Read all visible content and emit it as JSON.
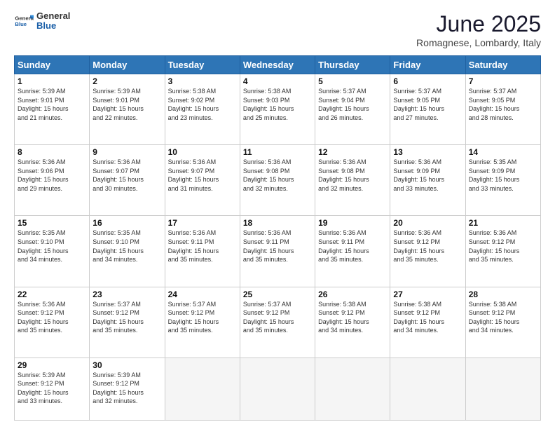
{
  "header": {
    "logo_general": "General",
    "logo_blue": "Blue",
    "month": "June 2025",
    "location": "Romagnese, Lombardy, Italy"
  },
  "weekdays": [
    "Sunday",
    "Monday",
    "Tuesday",
    "Wednesday",
    "Thursday",
    "Friday",
    "Saturday"
  ],
  "weeks": [
    [
      {
        "day": "1",
        "info": "Sunrise: 5:39 AM\nSunset: 9:01 PM\nDaylight: 15 hours\nand 21 minutes."
      },
      {
        "day": "2",
        "info": "Sunrise: 5:39 AM\nSunset: 9:01 PM\nDaylight: 15 hours\nand 22 minutes."
      },
      {
        "day": "3",
        "info": "Sunrise: 5:38 AM\nSunset: 9:02 PM\nDaylight: 15 hours\nand 23 minutes."
      },
      {
        "day": "4",
        "info": "Sunrise: 5:38 AM\nSunset: 9:03 PM\nDaylight: 15 hours\nand 25 minutes."
      },
      {
        "day": "5",
        "info": "Sunrise: 5:37 AM\nSunset: 9:04 PM\nDaylight: 15 hours\nand 26 minutes."
      },
      {
        "day": "6",
        "info": "Sunrise: 5:37 AM\nSunset: 9:05 PM\nDaylight: 15 hours\nand 27 minutes."
      },
      {
        "day": "7",
        "info": "Sunrise: 5:37 AM\nSunset: 9:05 PM\nDaylight: 15 hours\nand 28 minutes."
      }
    ],
    [
      {
        "day": "8",
        "info": "Sunrise: 5:36 AM\nSunset: 9:06 PM\nDaylight: 15 hours\nand 29 minutes."
      },
      {
        "day": "9",
        "info": "Sunrise: 5:36 AM\nSunset: 9:07 PM\nDaylight: 15 hours\nand 30 minutes."
      },
      {
        "day": "10",
        "info": "Sunrise: 5:36 AM\nSunset: 9:07 PM\nDaylight: 15 hours\nand 31 minutes."
      },
      {
        "day": "11",
        "info": "Sunrise: 5:36 AM\nSunset: 9:08 PM\nDaylight: 15 hours\nand 32 minutes."
      },
      {
        "day": "12",
        "info": "Sunrise: 5:36 AM\nSunset: 9:08 PM\nDaylight: 15 hours\nand 32 minutes."
      },
      {
        "day": "13",
        "info": "Sunrise: 5:36 AM\nSunset: 9:09 PM\nDaylight: 15 hours\nand 33 minutes."
      },
      {
        "day": "14",
        "info": "Sunrise: 5:35 AM\nSunset: 9:09 PM\nDaylight: 15 hours\nand 33 minutes."
      }
    ],
    [
      {
        "day": "15",
        "info": "Sunrise: 5:35 AM\nSunset: 9:10 PM\nDaylight: 15 hours\nand 34 minutes."
      },
      {
        "day": "16",
        "info": "Sunrise: 5:35 AM\nSunset: 9:10 PM\nDaylight: 15 hours\nand 34 minutes."
      },
      {
        "day": "17",
        "info": "Sunrise: 5:36 AM\nSunset: 9:11 PM\nDaylight: 15 hours\nand 35 minutes."
      },
      {
        "day": "18",
        "info": "Sunrise: 5:36 AM\nSunset: 9:11 PM\nDaylight: 15 hours\nand 35 minutes."
      },
      {
        "day": "19",
        "info": "Sunrise: 5:36 AM\nSunset: 9:11 PM\nDaylight: 15 hours\nand 35 minutes."
      },
      {
        "day": "20",
        "info": "Sunrise: 5:36 AM\nSunset: 9:12 PM\nDaylight: 15 hours\nand 35 minutes."
      },
      {
        "day": "21",
        "info": "Sunrise: 5:36 AM\nSunset: 9:12 PM\nDaylight: 15 hours\nand 35 minutes."
      }
    ],
    [
      {
        "day": "22",
        "info": "Sunrise: 5:36 AM\nSunset: 9:12 PM\nDaylight: 15 hours\nand 35 minutes."
      },
      {
        "day": "23",
        "info": "Sunrise: 5:37 AM\nSunset: 9:12 PM\nDaylight: 15 hours\nand 35 minutes."
      },
      {
        "day": "24",
        "info": "Sunrise: 5:37 AM\nSunset: 9:12 PM\nDaylight: 15 hours\nand 35 minutes."
      },
      {
        "day": "25",
        "info": "Sunrise: 5:37 AM\nSunset: 9:12 PM\nDaylight: 15 hours\nand 35 minutes."
      },
      {
        "day": "26",
        "info": "Sunrise: 5:38 AM\nSunset: 9:12 PM\nDaylight: 15 hours\nand 34 minutes."
      },
      {
        "day": "27",
        "info": "Sunrise: 5:38 AM\nSunset: 9:12 PM\nDaylight: 15 hours\nand 34 minutes."
      },
      {
        "day": "28",
        "info": "Sunrise: 5:38 AM\nSunset: 9:12 PM\nDaylight: 15 hours\nand 34 minutes."
      }
    ],
    [
      {
        "day": "29",
        "info": "Sunrise: 5:39 AM\nSunset: 9:12 PM\nDaylight: 15 hours\nand 33 minutes."
      },
      {
        "day": "30",
        "info": "Sunrise: 5:39 AM\nSunset: 9:12 PM\nDaylight: 15 hours\nand 32 minutes."
      },
      {
        "day": "",
        "info": ""
      },
      {
        "day": "",
        "info": ""
      },
      {
        "day": "",
        "info": ""
      },
      {
        "day": "",
        "info": ""
      },
      {
        "day": "",
        "info": ""
      }
    ]
  ]
}
